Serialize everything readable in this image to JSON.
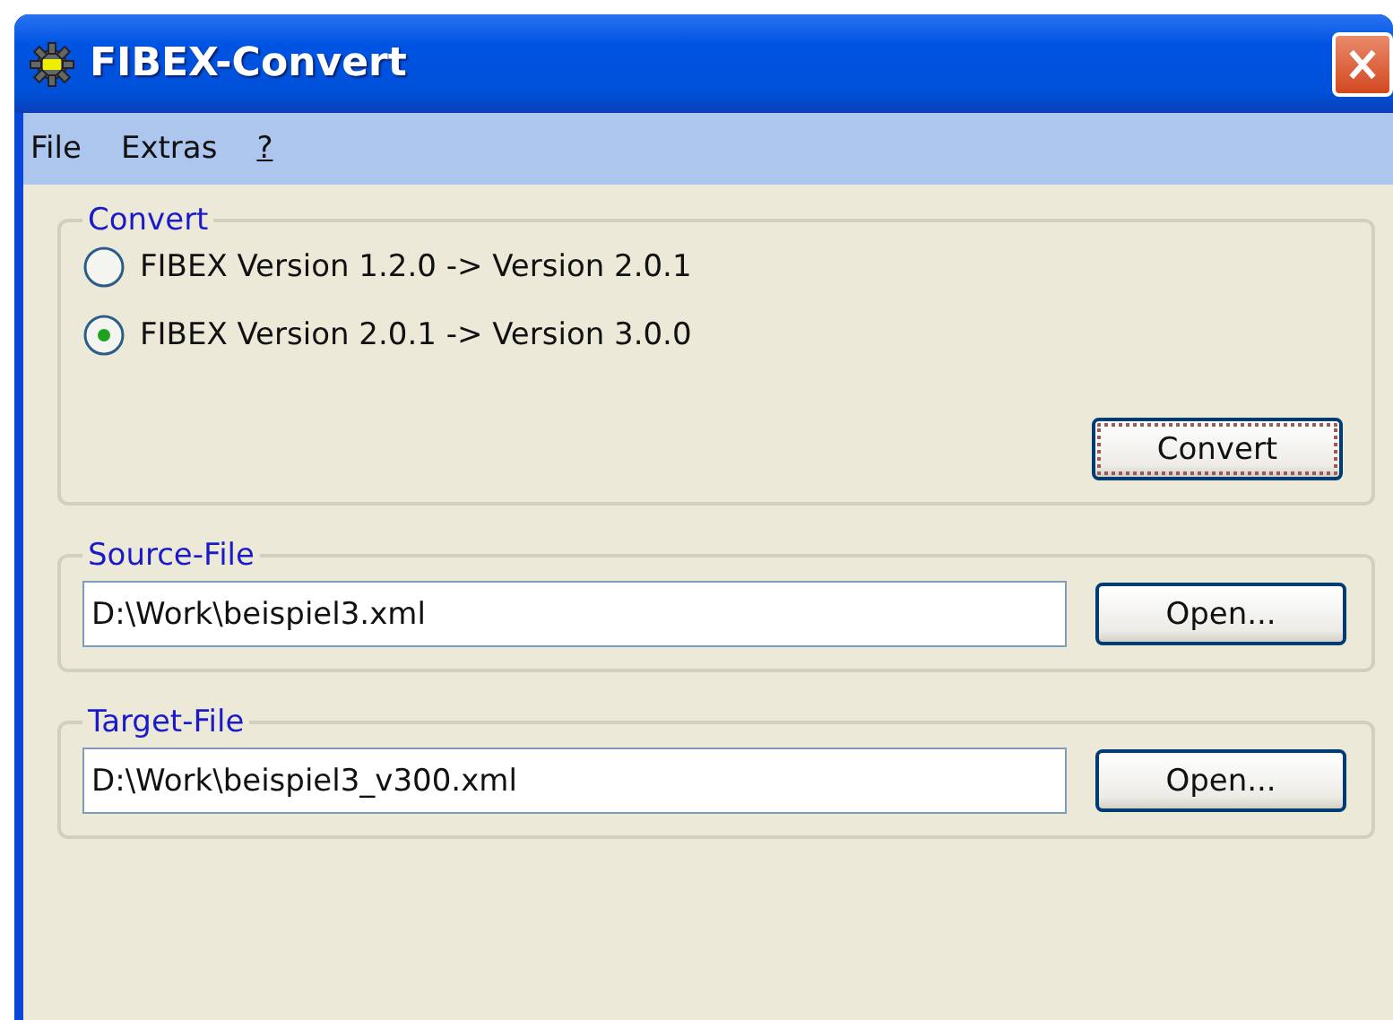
{
  "window": {
    "title": "FIBEX-Convert"
  },
  "menu": [
    "File",
    "Extras",
    "?"
  ],
  "convert": {
    "legend": "Convert",
    "options": [
      {
        "label": "FIBEX Version 1.2.0 -> Version 2.0.1",
        "selected": false
      },
      {
        "label": "FIBEX Version 2.0.1 -> Version 3.0.0",
        "selected": true
      }
    ],
    "button": "Convert"
  },
  "files": [
    {
      "legend": "Source-File",
      "value": "D:\\Work\\beispiel3.xml",
      "button": "Open..."
    },
    {
      "legend": "Target-File",
      "value": "D:\\Work\\beispiel3_v300.xml",
      "button": "Open..."
    }
  ]
}
